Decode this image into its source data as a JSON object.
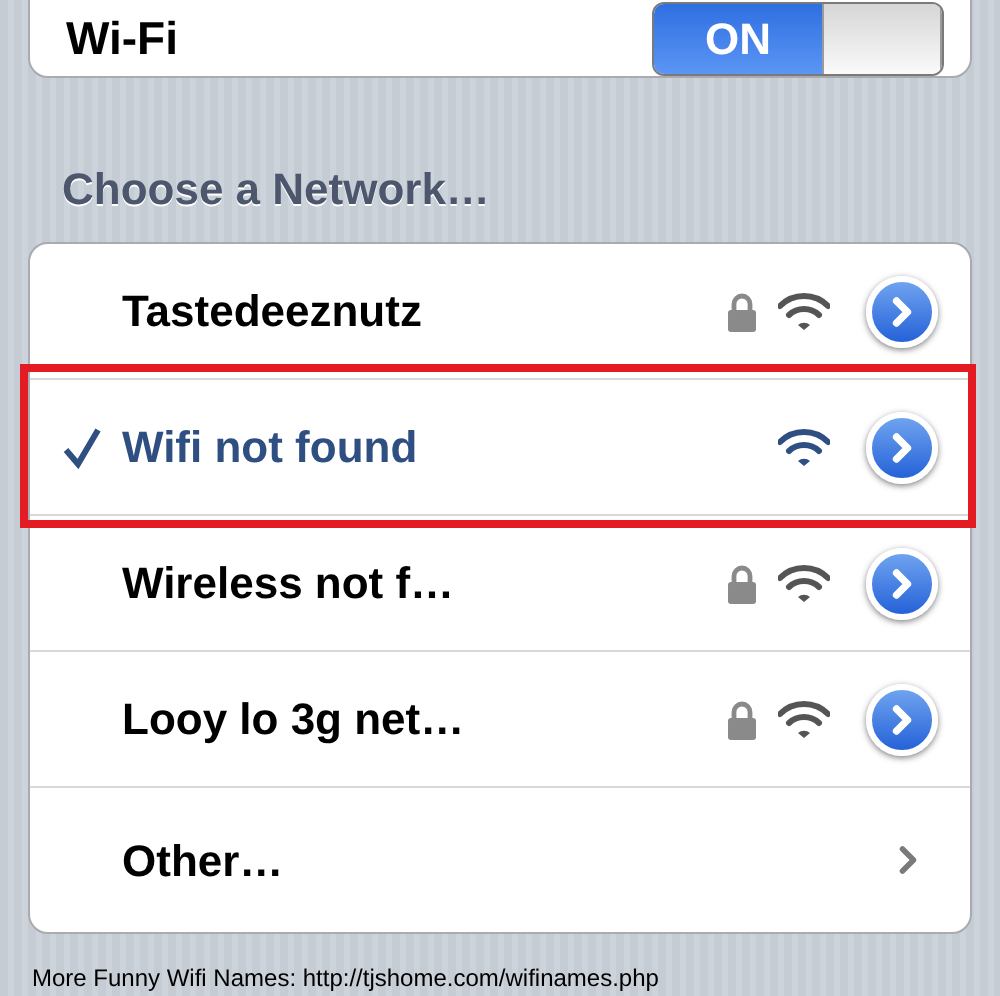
{
  "wifi": {
    "label": "Wi-Fi",
    "toggle": {
      "on": true,
      "label": "ON"
    }
  },
  "section_title": "Choose a Network…",
  "networks": [
    {
      "name": "Tastedeeznutz",
      "selected": false,
      "locked": true,
      "highlighted": false
    },
    {
      "name": "Wifi not found",
      "selected": true,
      "locked": false,
      "highlighted": true
    },
    {
      "name": "Wireless not f…",
      "selected": false,
      "locked": true,
      "highlighted": false
    },
    {
      "name": "Looy lo 3g net…",
      "selected": false,
      "locked": true,
      "highlighted": false
    }
  ],
  "other": {
    "label": "Other…"
  },
  "caption": "More Funny Wifi Names: http://tjshome.com/wifinames.php"
}
